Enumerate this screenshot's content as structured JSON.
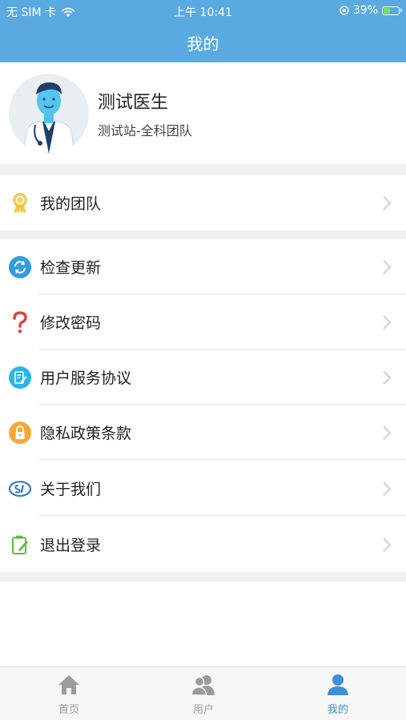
{
  "status_bar": {
    "carrier": "无 SIM 卡",
    "time": "上午 10:41",
    "battery": "39%",
    "battery_level": 0.39
  },
  "nav": {
    "title": "我的"
  },
  "profile": {
    "name": "测试医生",
    "team": "测试站-全科团队"
  },
  "menu": [
    {
      "label": "我的团队",
      "icon": "award-ribbon-icon"
    },
    {
      "label": "检查更新",
      "icon": "refresh-icon"
    },
    {
      "label": "修改密码",
      "icon": "question-mark-icon"
    },
    {
      "label": "用户服务协议",
      "icon": "document-edit-icon"
    },
    {
      "label": "隐私政策条款",
      "icon": "lock-icon"
    },
    {
      "label": "关于我们",
      "icon": "about-logo-icon"
    },
    {
      "label": "退出登录",
      "icon": "logout-clipboard-icon"
    }
  ],
  "tabs": [
    {
      "label": "首页",
      "icon": "home-icon"
    },
    {
      "label": "用户",
      "icon": "users-icon"
    },
    {
      "label": "我的",
      "icon": "person-icon",
      "active": true
    }
  ],
  "colors": {
    "primary": "#5aaae2",
    "tab_active": "#3d8fd6",
    "tab_inactive": "#9b9b9b"
  }
}
